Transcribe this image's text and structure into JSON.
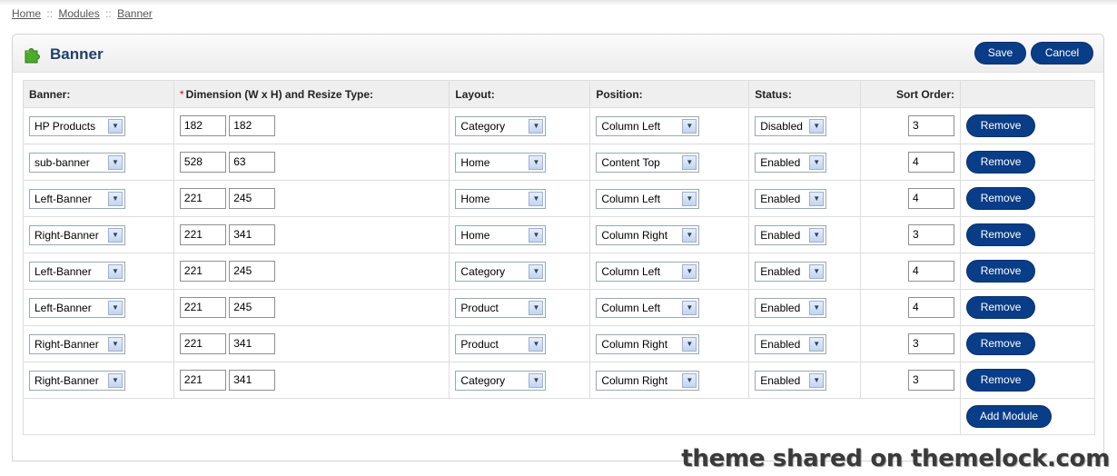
{
  "breadcrumb": {
    "home": "Home",
    "modules": "Modules",
    "banner": "Banner",
    "separator": "::"
  },
  "header": {
    "title": "Banner",
    "save_label": "Save",
    "cancel_label": "Cancel",
    "icon": "puzzle-piece-icon",
    "accent_color": "#0a3d87"
  },
  "table": {
    "columns": {
      "banner": "Banner:",
      "dimension_required": "*",
      "dimension": "Dimension (W x H) and Resize Type:",
      "layout": "Layout:",
      "position": "Position:",
      "status": "Status:",
      "sort_order": "Sort Order:"
    },
    "rows": [
      {
        "banner": "HP Products",
        "width": "182",
        "height": "182",
        "layout": "Category",
        "position": "Column Left",
        "status": "Disabled",
        "sort": "3",
        "remove": "Remove"
      },
      {
        "banner": "sub-banner",
        "width": "528",
        "height": "63",
        "layout": "Home",
        "position": "Content Top",
        "status": "Enabled",
        "sort": "4",
        "remove": "Remove"
      },
      {
        "banner": "Left-Banner",
        "width": "221",
        "height": "245",
        "layout": "Home",
        "position": "Column Left",
        "status": "Enabled",
        "sort": "4",
        "remove": "Remove"
      },
      {
        "banner": "Right-Banner",
        "width": "221",
        "height": "341",
        "layout": "Home",
        "position": "Column Right",
        "status": "Enabled",
        "sort": "3",
        "remove": "Remove"
      },
      {
        "banner": "Left-Banner",
        "width": "221",
        "height": "245",
        "layout": "Category",
        "position": "Column Left",
        "status": "Enabled",
        "sort": "4",
        "remove": "Remove"
      },
      {
        "banner": "Left-Banner",
        "width": "221",
        "height": "245",
        "layout": "Product",
        "position": "Column Left",
        "status": "Enabled",
        "sort": "4",
        "remove": "Remove"
      },
      {
        "banner": "Right-Banner",
        "width": "221",
        "height": "341",
        "layout": "Product",
        "position": "Column Right",
        "status": "Enabled",
        "sort": "3",
        "remove": "Remove"
      },
      {
        "banner": "Right-Banner",
        "width": "221",
        "height": "341",
        "layout": "Category",
        "position": "Column Right",
        "status": "Enabled",
        "sort": "3",
        "remove": "Remove"
      }
    ],
    "add_module_label": "Add Module"
  },
  "watermark": "theme shared on themelock.com"
}
